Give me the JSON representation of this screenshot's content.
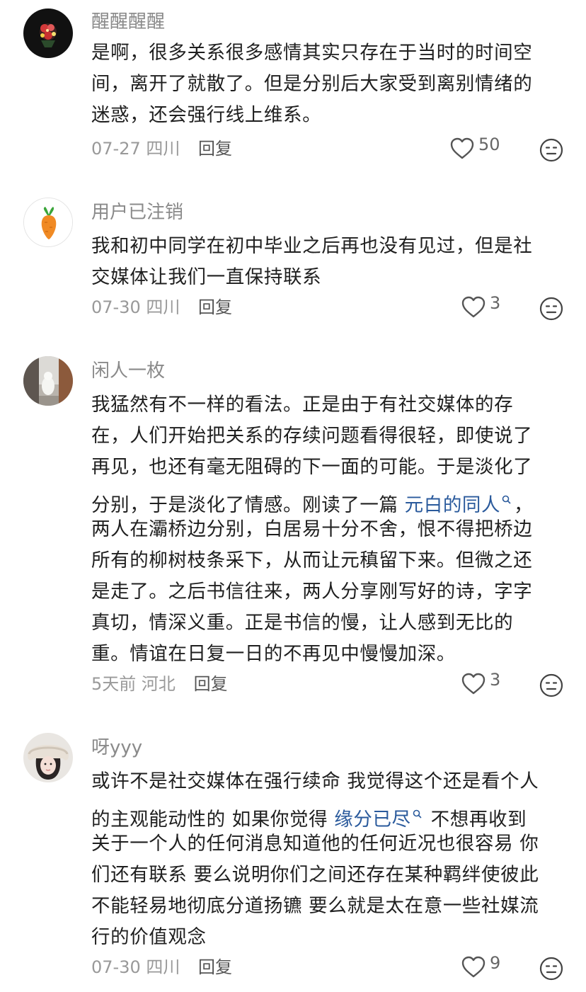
{
  "comments": [
    {
      "username": "醒醒醒醒",
      "lines": [
        [
          {
            "t": "是啊，很多关系很多感情其实只存在于当时的时间空"
          }
        ],
        [
          {
            "t": "间，离开了就散了。但是分别后大家受到离别情绪的"
          }
        ],
        [
          {
            "t": "迷惑，还会强行线上维系。"
          }
        ]
      ],
      "date": "07-27",
      "location": "四川",
      "reply_label": "回复",
      "likes": "50"
    },
    {
      "username": "用户已注销",
      "lines": [
        [
          {
            "t": "我和初中同学在初中毕业之后再也没有见过，但是社"
          }
        ],
        [
          {
            "t": "交媒体让我们一直保持联系"
          }
        ]
      ],
      "date": "07-30",
      "location": "四川",
      "reply_label": "回复",
      "likes": "3"
    },
    {
      "username": "闲人一枚",
      "lines": [
        [
          {
            "t": "我猛然有不一样的看法。正是由于有社交媒体的存"
          }
        ],
        [
          {
            "t": "在，人们开始把关系的存续问题看得很轻，即使说了"
          }
        ],
        [
          {
            "t": "再见，也还有毫无阻碍的下一面的可能。于是淡化了"
          }
        ],
        [
          {
            "t": "分别，于是淡化了情感。刚读了一篇 "
          },
          {
            "t": "元白的同人",
            "link": true
          },
          {
            "t": "，"
          }
        ],
        [
          {
            "t": "两人在灞桥边分别，白居易十分不舍，恨不得把桥边"
          }
        ],
        [
          {
            "t": "所有的柳树枝条采下，从而让元稹留下来。但微之还"
          }
        ],
        [
          {
            "t": "是走了。之后书信往来，两人分享刚写好的诗，字字"
          }
        ],
        [
          {
            "t": "真切，情深义重。正是书信的慢，让人感到无比的"
          }
        ],
        [
          {
            "t": "重。情谊在日复一日的不再见中慢慢加深。"
          }
        ]
      ],
      "date": "5天前",
      "location": "河北",
      "reply_label": "回复",
      "likes": "3"
    },
    {
      "username": "呀yyy",
      "lines": [
        [
          {
            "t": "或许不是社交媒体在强行续命 我觉得这个还是看个人"
          }
        ],
        [
          {
            "t": "的主观能动性的 如果你觉得 "
          },
          {
            "t": "缘分已尽",
            "link": true
          },
          {
            "t": " 不想再收到"
          }
        ],
        [
          {
            "t": "关于一个人的任何消息知道他的任何近况也很容易 你"
          }
        ],
        [
          {
            "t": "们还有联系 要么说明你们之间还存在某种羁绊使彼此"
          }
        ],
        [
          {
            "t": "不能轻易地彻底分道扬镳 要么就是太在意一些社媒流"
          }
        ],
        [
          {
            "t": "行的价值观念"
          }
        ]
      ],
      "date": "07-30",
      "location": "四川",
      "reply_label": "回复",
      "likes": "9"
    }
  ],
  "icons": {
    "like": "heart-outline-icon",
    "emoji": "neutral-face-icon",
    "link_suffix": "search-icon"
  },
  "colors": {
    "link": "#2a5a9c",
    "username": "#8a8a8a",
    "meta": "#999999"
  }
}
